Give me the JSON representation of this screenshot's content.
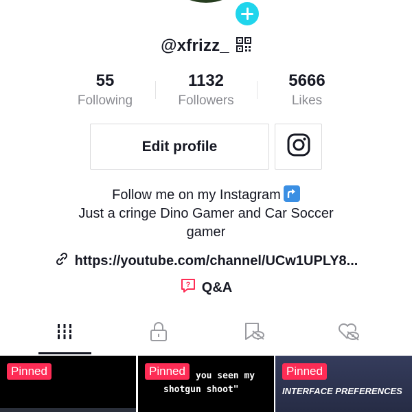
{
  "profile": {
    "username": "@xfrizz_"
  },
  "stats": [
    {
      "value": "55",
      "label": "Following"
    },
    {
      "value": "1132",
      "label": "Followers"
    },
    {
      "value": "5666",
      "label": "Likes"
    }
  ],
  "actions": {
    "edit_profile_label": "Edit profile"
  },
  "bio": {
    "line1": "Follow me on my Instagram",
    "line2": "Just a cringe Dino Gamer and Car Soccer",
    "line3": "gamer"
  },
  "link": {
    "text": "https://youtube.com/channel/UCw1UPLY8..."
  },
  "qa": {
    "label": "Q&A"
  },
  "tabs": [
    {
      "icon": "grid-icon",
      "active": true
    },
    {
      "icon": "lock-icon",
      "active": false
    },
    {
      "icon": "saved-icon",
      "active": false
    },
    {
      "icon": "liked-icon",
      "active": false
    }
  ],
  "videos": [
    {
      "badge": "Pinned",
      "caption": ""
    },
    {
      "badge": "Pinned",
      "caption_line1": "you seen my",
      "caption_line2": "shotgun shoot\""
    },
    {
      "badge": "Pinned",
      "caption": "INTERFACE PREFERENCES"
    }
  ],
  "colors": {
    "accent_pink": "#fe2c55",
    "add_button": "#20d5ec",
    "text_primary": "#161823",
    "text_secondary": "#8a8b91"
  }
}
